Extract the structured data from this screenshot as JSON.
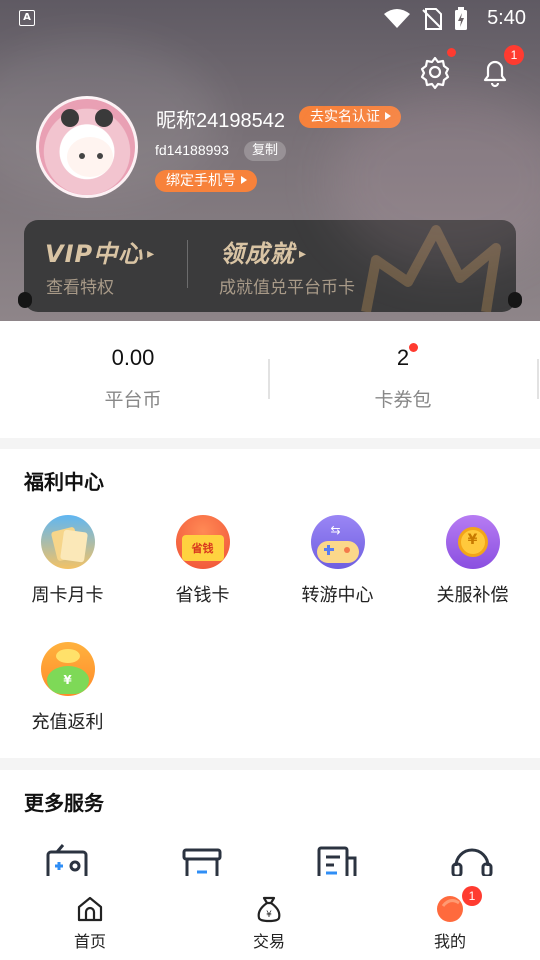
{
  "status_bar": {
    "time": "5:40",
    "icon_left": "A"
  },
  "header": {
    "notification_badge": "1",
    "nickname": "昵称24198542",
    "verify_label": "去实名认证",
    "user_id": "fd14188993",
    "copy_label": "复制",
    "bind_phone_label": "绑定手机号"
  },
  "vip_card": {
    "vip_title": "VIP中心",
    "vip_sub": "查看特权",
    "achieve_title": "领成就",
    "achieve_sub": "成就值兑平台币卡"
  },
  "stats": [
    {
      "value": "0.00",
      "label": "平台币"
    },
    {
      "value": "2",
      "label": "卡券包"
    }
  ],
  "welfare": {
    "title": "福利中心",
    "items": [
      {
        "label": "周卡月卡",
        "icon": "week-month-card-icon"
      },
      {
        "label": "省钱卡",
        "icon": "save-money-card-icon",
        "icon_text": "省钱"
      },
      {
        "label": "转游中心",
        "icon": "game-transfer-icon"
      },
      {
        "label": "关服补偿",
        "icon": "server-close-compensation-icon"
      },
      {
        "label": "充值返利",
        "icon": "recharge-rebate-icon"
      }
    ]
  },
  "more_services": {
    "title": "更多服务",
    "items": [
      "radio-icon",
      "gift-box-icon",
      "document-icon",
      "headset-icon"
    ]
  },
  "tabbar": {
    "items": [
      {
        "label": "首页",
        "icon": "home-icon"
      },
      {
        "label": "交易",
        "icon": "money-bag-icon"
      },
      {
        "label": "我的",
        "icon": "profile-icon",
        "badge": "1"
      }
    ]
  },
  "colors": {
    "accent_orange": "#f7823b",
    "badge_red": "#ff3b30",
    "vip_gold": "#d9c4a4",
    "vip_card_bg": "#3b3b3c"
  }
}
